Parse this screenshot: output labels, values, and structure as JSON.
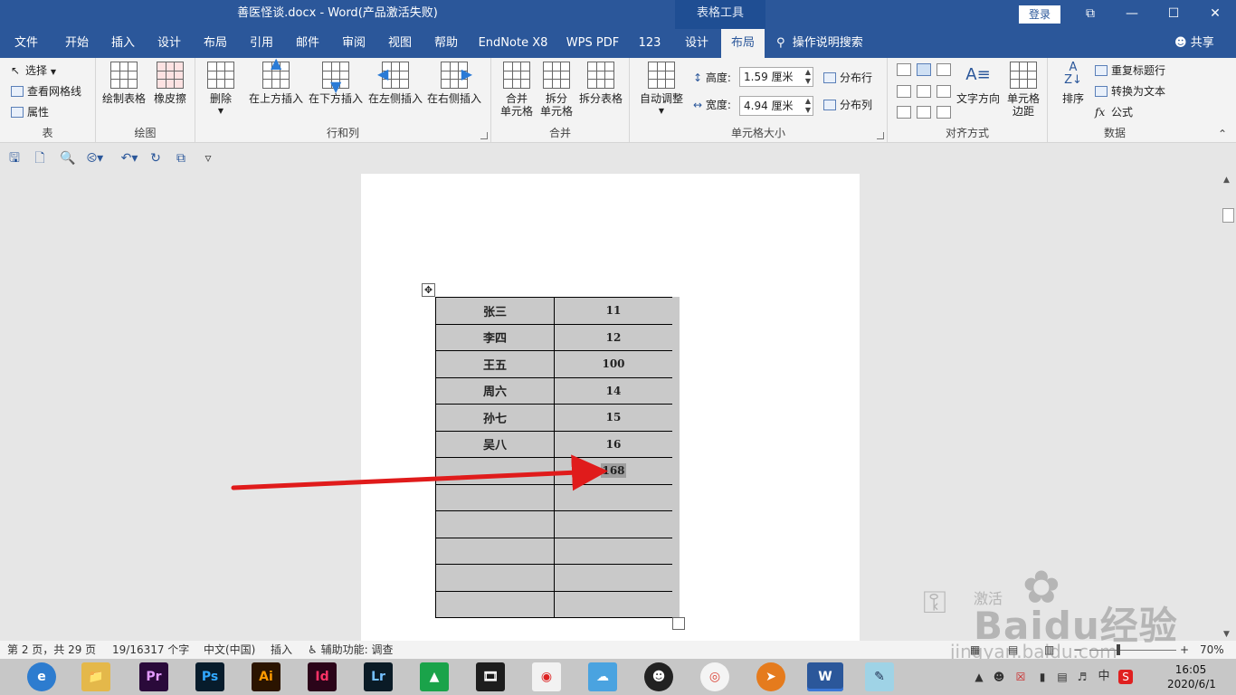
{
  "titlebar": {
    "document_title": "善医怪谈.docx  -  Word(产品激活失败)",
    "context_title": "表格工具",
    "login_label": "登录",
    "win_restore": "⧉",
    "win_minimize": "—",
    "win_maximize": "☐",
    "win_close": "✕"
  },
  "tabs": [
    "文件",
    "开始",
    "插入",
    "设计",
    "布局",
    "引用",
    "邮件",
    "审阅",
    "视图",
    "帮助",
    "EndNote X8",
    "WPS PDF",
    "123",
    "设计",
    "布局"
  ],
  "active_tab_index": 14,
  "tell_me": "操作说明搜索",
  "share": "共享",
  "ribbon": {
    "table_group": {
      "label": "表",
      "select": "选择",
      "view_gridlines": "查看网格线",
      "properties": "属性"
    },
    "draw_group": {
      "label": "绘图",
      "draw_table": "绘制表格",
      "eraser": "橡皮擦"
    },
    "rows_cols_group": {
      "label": "行和列",
      "delete": "删除",
      "insert_above": "在上方插入",
      "insert_below": "在下方插入",
      "insert_left": "在左侧插入",
      "insert_right": "在右侧插入"
    },
    "merge_group": {
      "label": "合并",
      "merge_cells_l1": "合并",
      "merge_cells_l2": "单元格",
      "split_cells_l1": "拆分",
      "split_cells_l2": "单元格",
      "split_table": "拆分表格"
    },
    "cell_size_group": {
      "label": "单元格大小",
      "autofit": "自动调整",
      "height_label": "高度:",
      "height_value": "1.59 厘米",
      "width_label": "宽度:",
      "width_value": "4.94 厘米",
      "distribute_rows": "分布行",
      "distribute_cols": "分布列"
    },
    "alignment_group": {
      "label": "对齐方式",
      "text_direction": "文字方向",
      "cell_margins_l1": "单元格",
      "cell_margins_l2": "边距"
    },
    "data_group": {
      "label": "数据",
      "sort": "排序",
      "repeat_header": "重复标题行",
      "convert_to_text": "转换为文本",
      "formula": "公式"
    }
  },
  "document": {
    "table_rows": [
      [
        "张三",
        "11"
      ],
      [
        "李四",
        "12"
      ],
      [
        "王五",
        "100"
      ],
      [
        "周六",
        "14"
      ],
      [
        "孙七",
        "15"
      ],
      [
        "吴八",
        "16"
      ],
      [
        "",
        "168"
      ],
      [
        "",
        ""
      ],
      [
        "",
        ""
      ],
      [
        "",
        ""
      ],
      [
        "",
        ""
      ],
      [
        "",
        ""
      ]
    ]
  },
  "statusbar": {
    "page": "第 2 页，共 29 页",
    "words": "19/16317 个字",
    "language": "中文(中国)",
    "mode": "插入",
    "accessibility": "辅助功能: 调查",
    "zoom": "70%"
  },
  "watermark": {
    "activate": "激活",
    "brand": "Baidu经验",
    "url": "jingyan.baidu.com"
  },
  "taskbar": {
    "apps": [
      "Edge",
      "Explorer",
      "Pr",
      "Ps",
      "Ai",
      "Id",
      "Lr",
      "Maps",
      "Video",
      "Game",
      "QQBrowser",
      "QQ",
      "Chrome",
      "Foxmail",
      "Word",
      "Notes"
    ],
    "ime": "中",
    "time": "16:05",
    "date": "2020/6/1"
  },
  "colors": {
    "word_blue": "#2b579a",
    "arrow_red": "#e01b1b",
    "cell_gray": "#c9c9c9"
  }
}
